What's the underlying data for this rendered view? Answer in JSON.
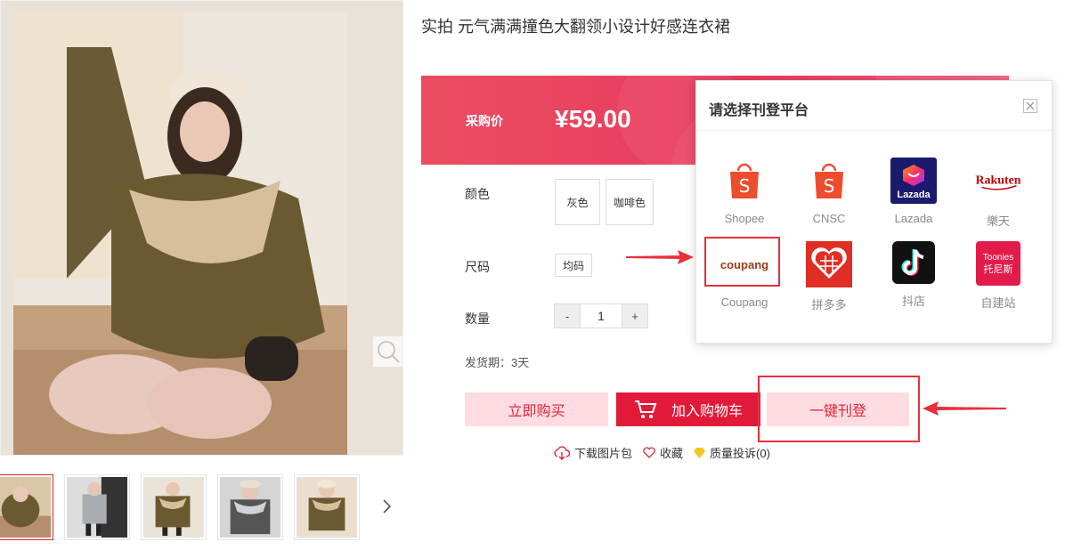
{
  "product": {
    "title": "实拍 元气满满撞色大翻领小设计好感连衣裙",
    "price_label": "采购价",
    "price": "¥59.00",
    "color_label": "颜色",
    "colors": [
      "灰色",
      "咖啡色"
    ],
    "size_label": "尺码",
    "sizes": [
      "均码"
    ],
    "qty_label": "数量",
    "qty_minus": "-",
    "qty_value": "1",
    "qty_plus": "+",
    "ship": "发货期：3天"
  },
  "actions": {
    "buy": "立即购买",
    "cart": "加入购物车",
    "publish": "一键刊登"
  },
  "links": {
    "download": "下载图片包",
    "favorite": "收藏",
    "complaint": "质量投诉(0)"
  },
  "modal": {
    "title": "请选择刊登平台",
    "platforms": [
      {
        "name": "Shopee",
        "icon": "shopee-bag-icon"
      },
      {
        "name": "CNSC",
        "icon": "shopee-bag-icon"
      },
      {
        "name": "Lazada",
        "icon": "lazada-logo"
      },
      {
        "name": "樂天",
        "icon": "rakuten-logo"
      },
      {
        "name": "Coupang",
        "icon": "coupang-logo"
      },
      {
        "name": "拼多多",
        "icon": "pinduoduo-logo"
      },
      {
        "name": "抖店",
        "icon": "douyin-logo"
      },
      {
        "name": "自建站",
        "icon": "toonies-logo"
      }
    ],
    "logo_text": {
      "shopee": "S",
      "lazada": "Lazada",
      "rakuten": "Rakuten",
      "coupang": "coupang",
      "toonies_1": "Toonies",
      "toonies_2": "托尼斯"
    }
  },
  "colors": {
    "accent": "#e21a3a",
    "price_banner": "#e83a5e",
    "annotation_red": "#e8303b"
  }
}
